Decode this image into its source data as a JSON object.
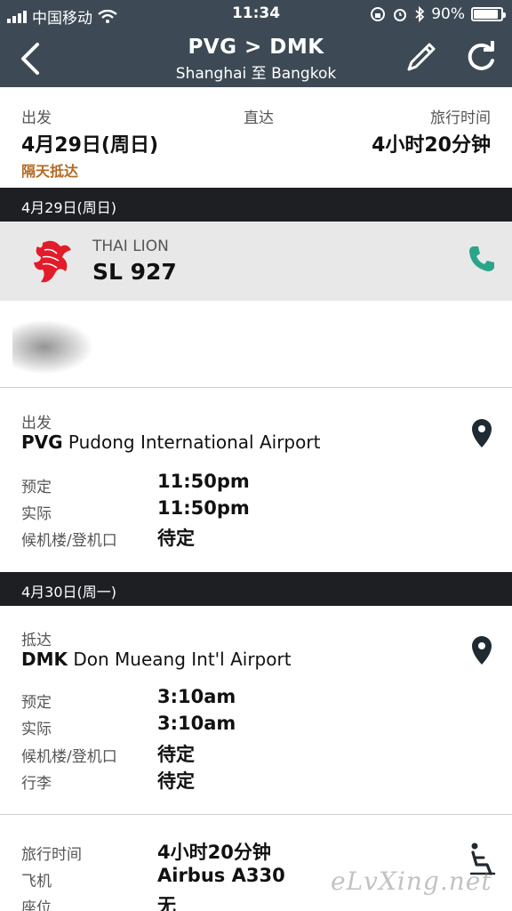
{
  "status_bar": {
    "carrier": "中国移动",
    "time": "11:34",
    "battery": "90%",
    "battery_level": 0.9
  },
  "nav": {
    "route": "PVG > DMK",
    "subtitle": "Shanghai 至 Bangkok",
    "icons": [
      "back-chevron-icon",
      "edit-pencil-icon",
      "refresh-icon"
    ]
  },
  "summary": {
    "depart_label": "出发",
    "depart_date": "4月29日(周日)",
    "next_day": "隔天抵达",
    "direct": "直达",
    "duration_label": "旅行时间",
    "duration": "4小时20分钟",
    "next_day_color": "#b26a24"
  },
  "day1": "4月29日(周日)",
  "airline": {
    "name": "THAI LION",
    "flight_number": "SL 927",
    "accent_color": "#e21c2a",
    "phone_color": "#2aa58a"
  },
  "departure": {
    "label": "出发",
    "code": "PVG",
    "airport": "Pudong International Airport",
    "rows": [
      {
        "key": "预定",
        "value": "11:50pm"
      },
      {
        "key": "实际",
        "value": "11:50pm"
      },
      {
        "key": "候机楼/登机口",
        "value": "待定"
      }
    ]
  },
  "day2": "4月30日(周一)",
  "arrival": {
    "label": "抵达",
    "code": "DMK",
    "airport": "Don Mueang Int'l Airport",
    "rows": [
      {
        "key": "预定",
        "value": "3:10am"
      },
      {
        "key": "实际",
        "value": "3:10am"
      },
      {
        "key": "候机楼/登机口",
        "value": "待定"
      },
      {
        "key": "行李",
        "value": "待定"
      }
    ]
  },
  "details": {
    "rows": [
      {
        "key": "旅行时间",
        "value": "4小时20分钟"
      },
      {
        "key": "飞机",
        "value": "Airbus A330"
      },
      {
        "key": "座位",
        "value": "无"
      }
    ]
  },
  "watermark": "eLvXing.net"
}
